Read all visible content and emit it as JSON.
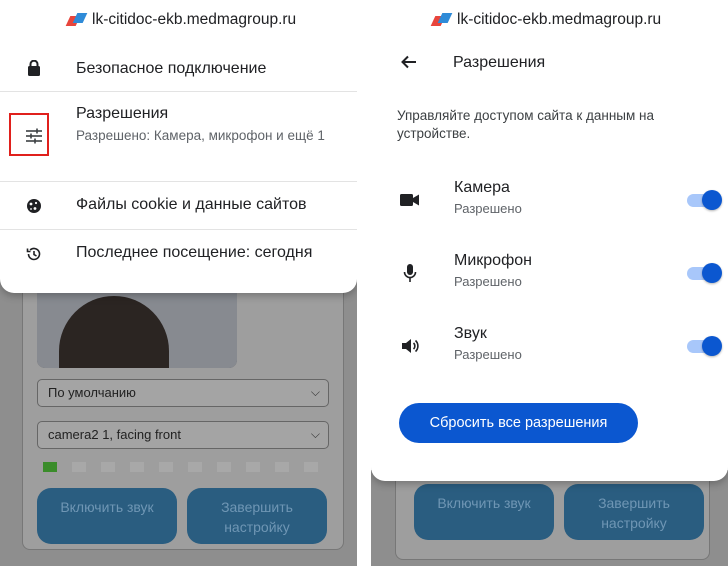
{
  "site": {
    "host": "lk-citidoc-ekb.medmagroup.ru"
  },
  "site_info_menu": {
    "items": [
      {
        "icon": "lock-icon",
        "label": "Безопасное подключение"
      },
      {
        "icon": "tune-sliders-icon",
        "label": "Разрешения",
        "sublabel": "Разрешено: Камера, микрофон и ещё 1",
        "highlighted": true
      },
      {
        "icon": "cookie-icon",
        "label": "Файлы cookie и данные сайтов"
      },
      {
        "icon": "history-icon",
        "label": "Последнее посещение: сегодня"
      }
    ]
  },
  "background_page": {
    "selects": [
      {
        "value": "По умолчанию"
      },
      {
        "value": "camera2 1, facing front"
      }
    ],
    "buttons": {
      "enable_sound": "Включить звук",
      "finish_setup": "Завершить настройку"
    },
    "sound_level": {
      "active_bars": 1,
      "total_bars": 10
    }
  },
  "permissions_page": {
    "title": "Разрешения",
    "description": "Управляйте доступом сайта к данным на устройстве.",
    "permissions": [
      {
        "icon": "camera-icon",
        "name": "Камера",
        "status": "Разрешено",
        "enabled": true
      },
      {
        "icon": "microphone-icon",
        "name": "Микрофон",
        "status": "Разрешено",
        "enabled": true
      },
      {
        "icon": "speaker-icon",
        "name": "Звук",
        "status": "Разрешено",
        "enabled": true
      }
    ],
    "reset_button": "Сбросить все разрешения"
  },
  "colors": {
    "accent": "#0b57d0",
    "toggle_track": "#a8c7fa",
    "highlight_box": "#e0201c"
  }
}
